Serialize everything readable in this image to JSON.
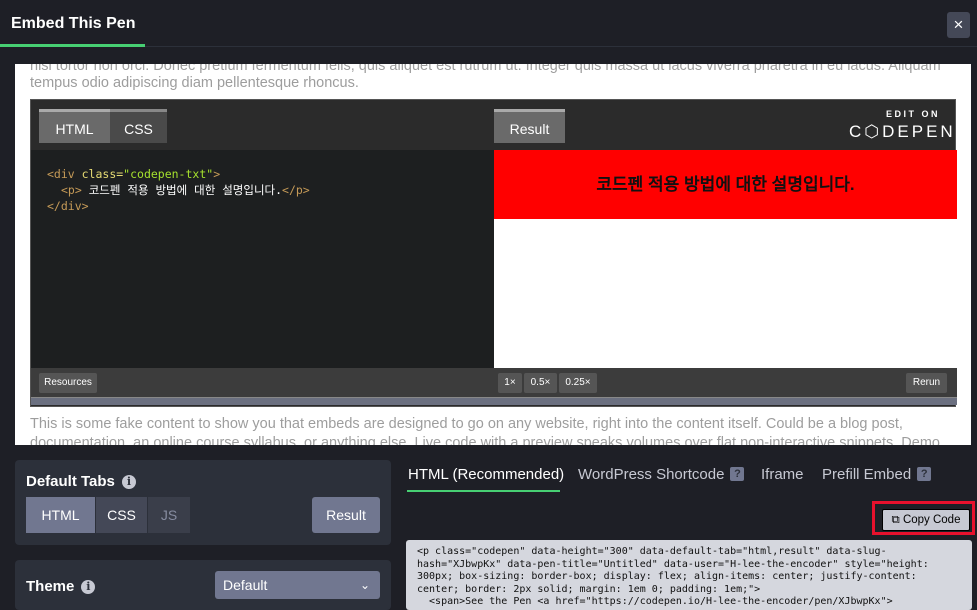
{
  "header": {
    "title": "Embed This Pen",
    "close_label": "×"
  },
  "preview": {
    "fake_top_line1": "nisi tortor non orci. Donec pretium fermentum felis, quis aliquet est rutrum ut. Integer quis massa ut lacus viverra pharetra in eu lacus. Aliquam",
    "fake_top_line2": "tempus odio adipiscing diam pellentesque rhoncus.",
    "fake_bottom_line1": "This is some fake content to show you that embeds are designed to go on any website, right into the content itself. Could be a blog post,",
    "fake_bottom_line2": "documentation, an online course syllabus, or anything else. Live code with a preview speaks volumes over flat non-interactive snippets. Demo",
    "embed": {
      "tab_html": "HTML",
      "tab_css": "CSS",
      "tab_result": "Result",
      "logo_edit": "EDIT ON",
      "logo_name": "C⬡DEPEN",
      "code": {
        "l1_tag1": "<div ",
        "l1_attr": "class=",
        "l1_str": "\"codepen-txt\"",
        "l1_tag2": ">",
        "l2_tag1": "<p>",
        "l2_text": " 코드펜 적용 방법에 대한 설명입니다.",
        "l2_tag2": "</p>",
        "l3_tag": "</div>"
      },
      "result_text": "코드펜 적용 방법에 대한 설명입니다.",
      "resources": "Resources",
      "zoom_1": "1×",
      "zoom_05": "0.5×",
      "zoom_025": "0.25×",
      "rerun": "Rerun"
    }
  },
  "default_tabs": {
    "title": "Default Tabs",
    "info": "i",
    "html": "HTML",
    "css": "CSS",
    "js": "JS",
    "result": "Result"
  },
  "theme": {
    "title": "Theme",
    "info": "i",
    "value": "Default",
    "chevron": "⌄"
  },
  "output_tabs": {
    "html": "HTML (Recommended)",
    "wordpress": "WordPress Shortcode",
    "iframe": "Iframe",
    "prefill": "Prefill Embed",
    "help": "?"
  },
  "copy_code": {
    "icon": "⧉",
    "label": "Copy Code"
  },
  "output_code": "<p class=\"codepen\" data-height=\"300\" data-default-tab=\"html,result\" data-slug-\nhash=\"XJbwpKx\" data-pen-title=\"Untitled\" data-user=\"H-lee-the-encoder\" style=\"height:\n300px; box-sizing: border-box; display: flex; align-items: center; justify-content:\ncenter; border: 2px solid; margin: 1em 0; padding: 1em;\">\n  <span>See the Pen <a href=\"https://codepen.io/H-lee-the-encoder/pen/XJbwpKx\">"
}
